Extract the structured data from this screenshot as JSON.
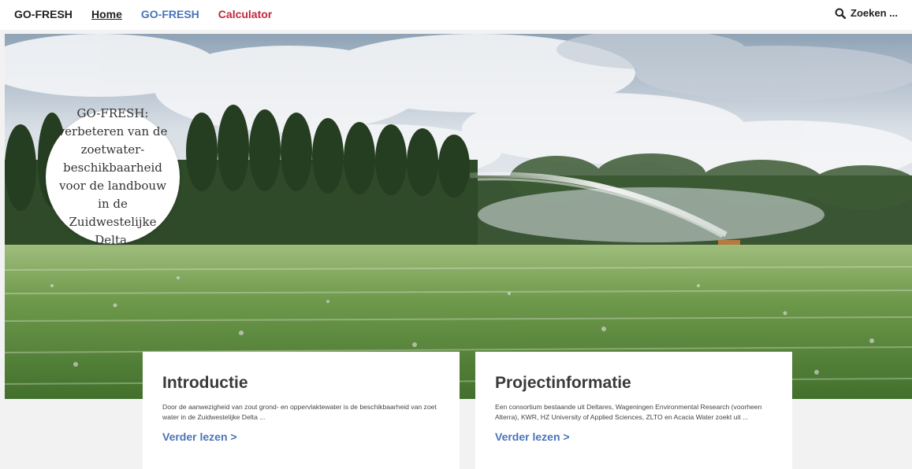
{
  "brand": {
    "label": "GO-FRESH"
  },
  "nav": {
    "items": [
      {
        "label": "Home",
        "color": "#222222"
      },
      {
        "label": "GO-FRESH",
        "color": "#4a73b8"
      },
      {
        "label": "Calculator",
        "color": "#c0283d"
      }
    ]
  },
  "search": {
    "placeholder": "Zoeken ...",
    "icon": "search-icon"
  },
  "hero": {
    "image": "irrigation-sprinkler-potato-field",
    "bubble_text": "GO-FRESH: verbeteren van de zoetwater-beschikbaarheid voor de landbouw in de Zuidwestelijke Delta."
  },
  "cards": [
    {
      "title": "Introductie",
      "text": "Door de aanwezigheid van zout grond- en oppervlaktewater is de beschikbaarheid van zoet water in de Zuidwestelijke Delta ...",
      "link": "Verder lezen >"
    },
    {
      "title": "Projectinformatie",
      "text": "Een consortium bestaande uit Deltares, Wageningen Environmental Research (voorheen Alterra), KWR, HZ University of Applied Sciences, ZLTO en Acacia Water zoekt uit ...",
      "link": "Verder lezen >"
    }
  ],
  "colors": {
    "link": "#4a73b8",
    "calculator": "#c0283d",
    "text": "#222222"
  }
}
